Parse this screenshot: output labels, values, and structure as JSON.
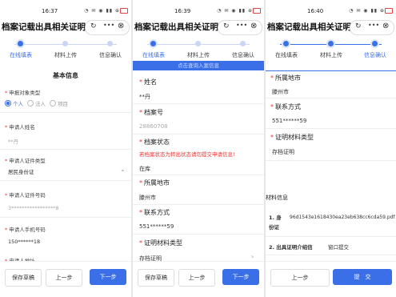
{
  "common": {
    "title": "档案记载出具相关证明",
    "capsule_icons": [
      "rotate-icon",
      "more-icon",
      "close-icon"
    ],
    "status_indicators": "◔ ✉ ◉ ▮▮ ⊕",
    "steps": [
      "在线填表",
      "材料上传",
      "信息确认"
    ],
    "accent": "#3b6fe8",
    "required_mark": "*"
  },
  "panel1": {
    "time": "16:37",
    "section_title": "基本信息",
    "applicant_type_label": "申报对象类型",
    "applicant_type_options": [
      "个人",
      "法人",
      "项目"
    ],
    "applicant_type_selected": "个人",
    "name_label": "申请人姓名",
    "name_value": "**丹",
    "id_type_label": "申请人证件类型",
    "id_type_value": "居民身份证",
    "id_number_label": "申请人证件号码",
    "id_number_value": "3*****************8",
    "phone_label": "申请人手机号码",
    "phone_value": "150******18",
    "partial_label": "申请人地址",
    "buttons": {
      "save": "保存草稿",
      "prev": "上一步",
      "next": "下一步"
    }
  },
  "panel2": {
    "time": "16:39",
    "banner": "点击查询入案信息",
    "name_label": "姓名",
    "name_value": "**丹",
    "archive_no_label": "档案号",
    "archive_no_value": "28860708",
    "archive_status_label": "档案状态",
    "archive_status_warning": "若档案状态为转出状态请勿提交申请信息!",
    "archive_status_value": "在库",
    "location_label": "所属地市",
    "location_value": "滕州市",
    "contact_label": "联系方式",
    "contact_value": "551******59",
    "material_type_label": "证明材料类型",
    "material_type_value": "存档证明",
    "buttons": {
      "save": "保存草稿",
      "prev": "上一步",
      "next": "下一步"
    }
  },
  "panel3": {
    "time": "16:40",
    "location_label": "所属地市",
    "location_value": "滕州市",
    "contact_label": "联系方式",
    "contact_value": "551******59",
    "material_type_label": "证明材料类型",
    "material_type_value": "存档证明",
    "materials_title": "材料信息",
    "materials": [
      {
        "key": "1. 身份证",
        "value": "96d1543e1618430ea23eb638cc6cda59.pdf"
      },
      {
        "key": "2. 出具证明介绍信",
        "value": "窗口提交"
      }
    ],
    "buttons": {
      "prev": "上一步",
      "submit": "提　交"
    }
  }
}
